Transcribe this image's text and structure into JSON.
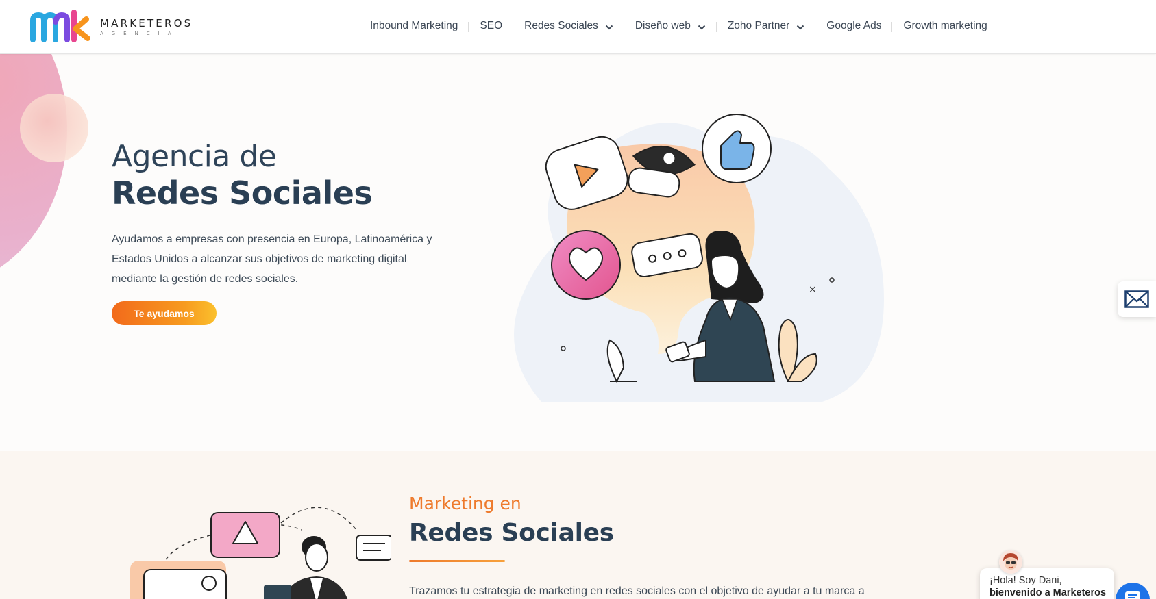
{
  "brand": {
    "name": "MARKETEROS",
    "subtitle": "AGENCIA",
    "colors": {
      "orange": "#f26a1b",
      "navy": "#2a3f54",
      "pink": "#e9b0cc",
      "blue": "#1e73e8"
    }
  },
  "nav": {
    "items": [
      {
        "label": "Inbound Marketing",
        "dropdown": false
      },
      {
        "label": "SEO",
        "dropdown": false
      },
      {
        "label": "Redes Sociales",
        "dropdown": true
      },
      {
        "label": "Diseño web",
        "dropdown": true
      },
      {
        "label": "Zoho Partner",
        "dropdown": true
      },
      {
        "label": "Google Ads",
        "dropdown": false
      },
      {
        "label": "Growth marketing",
        "dropdown": false
      }
    ]
  },
  "hero": {
    "title_line1": "Agencia de",
    "title_line2": "Redes Sociales",
    "description": "Ayudamos a empresas con presencia en Europa, Latinoamérica y Estados Unidos a alcanzar sus objetivos de marketing digital mediante la gestión de redes sociales.",
    "cta": "Te ayudamos"
  },
  "section2": {
    "kicker": "Marketing en",
    "title": "Redes Sociales",
    "text": "Trazamos tu estrategia de marketing en redes sociales con el objetivo de ayudar a tu marca a"
  },
  "chat": {
    "greeting": "¡Hola! Soy Dani,",
    "welcome": "bienvenido a Marketeros"
  },
  "icons": [
    "chevron-down-icon",
    "mail-icon",
    "chat-icon",
    "logo-icon"
  ]
}
